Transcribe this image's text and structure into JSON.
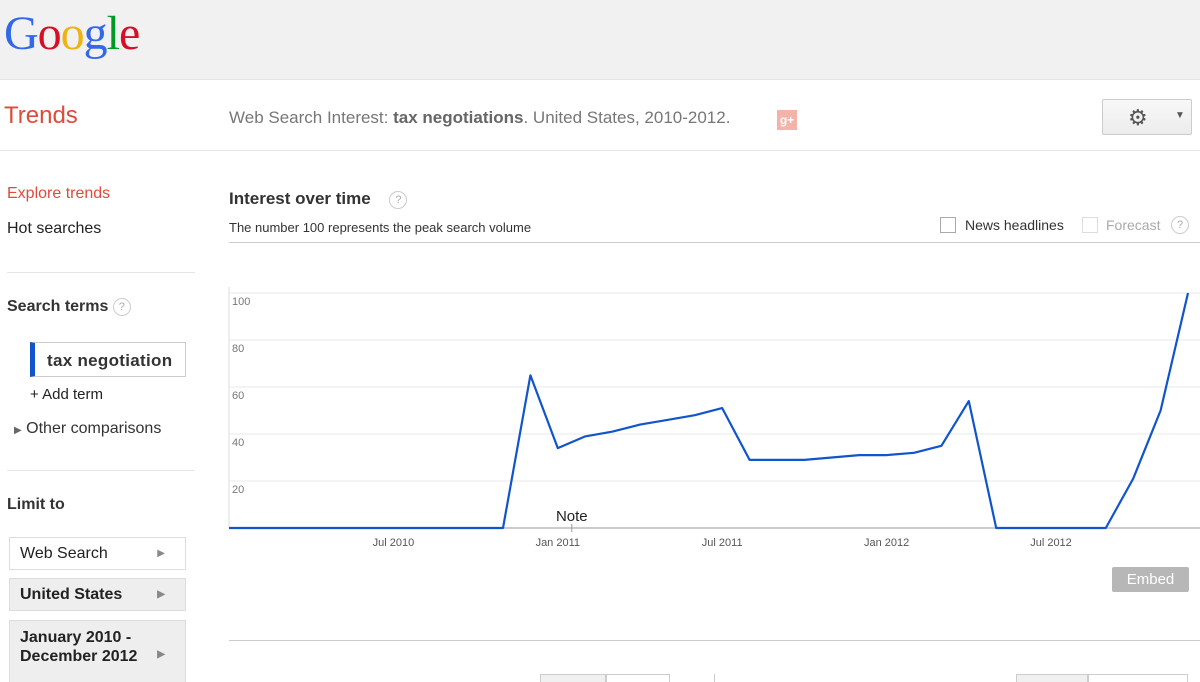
{
  "logo": {
    "letters": [
      "G",
      "o",
      "o",
      "g",
      "l",
      "e"
    ],
    "colors": [
      "#3369e8",
      "#d50f25",
      "#eeb211",
      "#3369e8",
      "#009925",
      "#d50f25"
    ]
  },
  "header": {
    "product": "Trends",
    "title_prefix": "Web Search Interest: ",
    "title_term": "tax negotiations",
    "title_suffix": ". United States, 2010-2012.",
    "gplus_label": "g+",
    "settings_icon": "gear-icon"
  },
  "sidebar": {
    "explore": "Explore trends",
    "hot": "Hot searches",
    "search_terms_heading": "Search terms",
    "term": "tax negotiation",
    "add_term": "Add term",
    "other_comparisons": "Other comparisons",
    "limit_heading": "Limit to",
    "limits": [
      "Web Search",
      "United States",
      "January 2010 - December 2012"
    ]
  },
  "main": {
    "heading": "Interest over time",
    "subheading": "The number 100 represents the peak search volume",
    "news_headlines": "News headlines",
    "forecast": "Forecast",
    "embed": "Embed",
    "note": "Note"
  },
  "chart_data": {
    "type": "line",
    "xlabel": "",
    "ylabel": "",
    "ylim": [
      0,
      100
    ],
    "yticks": [
      20,
      40,
      60,
      80,
      100
    ],
    "x_ticks": [
      "Jul 2010",
      "Jan 2011",
      "Jul 2011",
      "Jan 2012",
      "Jul 2012"
    ],
    "x_range": [
      "2010-01",
      "2012-12"
    ],
    "grid": true,
    "series": [
      {
        "color": "#1155cc",
        "x": [
          "2010-01",
          "2010-02",
          "2010-03",
          "2010-04",
          "2010-05",
          "2010-06",
          "2010-07",
          "2010-08",
          "2010-09",
          "2010-10",
          "2010-11",
          "2010-12",
          "2011-01",
          "2011-02",
          "2011-03",
          "2011-04",
          "2011-05",
          "2011-06",
          "2011-07",
          "2011-08",
          "2011-09",
          "2011-10",
          "2011-11",
          "2011-12",
          "2012-01",
          "2012-02",
          "2012-03",
          "2012-04",
          "2012-05",
          "2012-06",
          "2012-07",
          "2012-08",
          "2012-09",
          "2012-10",
          "2012-11",
          "2012-12"
        ],
        "values": [
          0,
          0,
          0,
          0,
          0,
          0,
          0,
          0,
          0,
          0,
          0,
          65,
          34,
          39,
          41,
          44,
          46,
          48,
          51,
          29,
          29,
          29,
          30,
          31,
          31,
          32,
          35,
          54,
          0,
          0,
          0,
          0,
          0,
          21,
          50,
          100
        ]
      }
    ]
  }
}
